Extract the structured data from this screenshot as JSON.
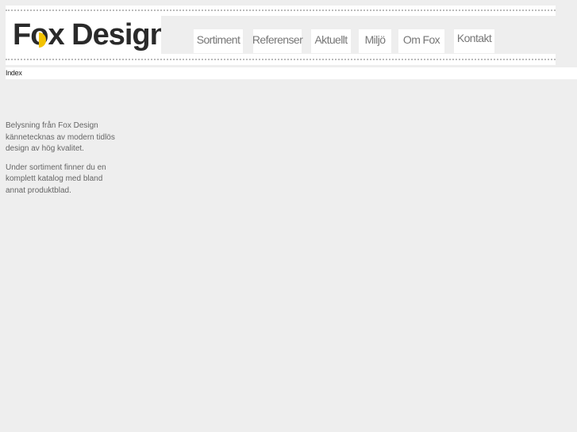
{
  "logo": {
    "text_before": "F",
    "text_o": "o",
    "text_after": "x Design",
    "accent_color": "#f2c200"
  },
  "nav": {
    "items": [
      "Sortiment",
      "Referenser",
      "Aktuellt",
      "Miljö",
      "Om Fox",
      "Kontakt"
    ]
  },
  "breadcrumb": {
    "label": "Index"
  },
  "content": {
    "paragraphs": [
      "Belysning från Fox Design kännetecknas av modern tidlös design av hög kvalitet.",
      "Under sortiment finner du en komplett katalog med bland annat produktblad."
    ]
  }
}
